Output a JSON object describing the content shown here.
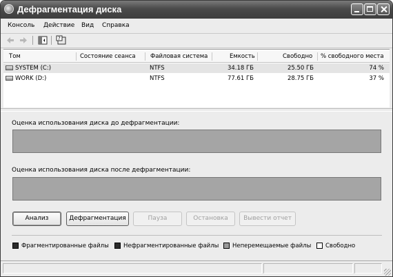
{
  "window": {
    "title": "Дефрагментация диска"
  },
  "menu": [
    "Консоль",
    "Действие",
    "Вид",
    "Справка"
  ],
  "table": {
    "columns": [
      "Том",
      "Состояние сеанса",
      "Файловая система",
      "Емкость",
      "Свободно",
      "% свободного места"
    ],
    "rows": [
      {
        "volume": "SYSTEM (C:)",
        "state": "",
        "fs": "NTFS",
        "capacity": "34.18 ГБ",
        "free": "25.50 ГБ",
        "free_pct": "74 %"
      },
      {
        "volume": "WORK (D:)",
        "state": "",
        "fs": "NTFS",
        "capacity": "77.61 ГБ",
        "free": "28.75 ГБ",
        "free_pct": "37 %"
      }
    ]
  },
  "before_label": "Оценка использования диска до дефрагментации:",
  "after_label": "Оценка использования диска после дефрагментации:",
  "buttons": {
    "analyze": "Анализ",
    "defrag": "Дефрагментация",
    "pause": "Пауза",
    "stop": "Остановка",
    "report": "Вывести отчет"
  },
  "legend": [
    {
      "label": "Фрагментированные файлы",
      "color": "#2b2b2b"
    },
    {
      "label": "Нефрагментированные файлы",
      "color": "#2b2b2b"
    },
    {
      "label": "Неперемещаемые файлы",
      "color": "#9a9a9a"
    },
    {
      "label": "Свободно",
      "color": "#ffffff"
    }
  ],
  "icons": [
    "back-arrow-icon",
    "forward-arrow-icon",
    "show-hide-tree-icon",
    "help-icon",
    "app-icon",
    "drive-icon",
    "resize-grip-icon"
  ]
}
